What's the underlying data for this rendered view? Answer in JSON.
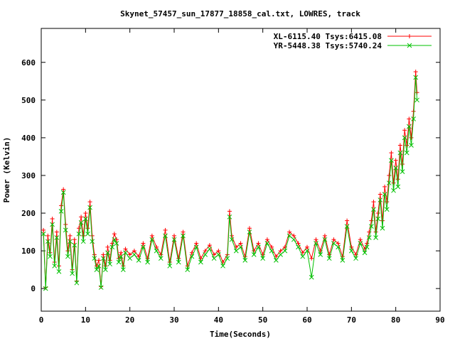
{
  "chart_data": {
    "type": "line",
    "title": "Skynet_57457_sun_17877_18858_cal.txt, LOWRES, track",
    "xlabel": "Time(Seconds)",
    "ylabel": "Power (Kelvin)",
    "xlim": [
      0,
      90
    ],
    "ylim": [
      -60,
      690
    ],
    "xticks": [
      0,
      10,
      20,
      30,
      40,
      50,
      60,
      70,
      80,
      90
    ],
    "yticks": [
      0,
      100,
      200,
      300,
      400,
      500,
      600
    ],
    "grid": false,
    "legend_position": "top-right",
    "series": [
      {
        "name": "XL-6115.40 Tsys:6415.08",
        "color": "#ff0000",
        "marker": "plus",
        "x": [
          0.5,
          1.0,
          1.5,
          2.0,
          2.5,
          3.0,
          3.5,
          4.0,
          4.5,
          5.0,
          5.5,
          6.0,
          6.5,
          7.0,
          7.5,
          8.0,
          8.5,
          9.0,
          9.5,
          10.0,
          10.5,
          11.0,
          11.5,
          12.0,
          12.5,
          13.0,
          13.5,
          14.0,
          14.5,
          15.0,
          15.5,
          16.0,
          16.5,
          17.0,
          17.5,
          18.0,
          18.5,
          19.0,
          20.0,
          21.0,
          22.0,
          23.0,
          24.0,
          25.0,
          26.0,
          27.0,
          28.0,
          29.0,
          30.0,
          31.0,
          32.0,
          33.0,
          34.0,
          35.0,
          36.0,
          37.0,
          38.0,
          39.0,
          40.0,
          41.0,
          42.0,
          42.5,
          43.0,
          44.0,
          45.0,
          46.0,
          47.0,
          48.0,
          49.0,
          50.0,
          51.0,
          52.0,
          53.0,
          54.0,
          55.0,
          56.0,
          57.0,
          58.0,
          59.0,
          60.0,
          61.0,
          62.0,
          63.0,
          64.0,
          65.0,
          66.0,
          67.0,
          68.0,
          69.0,
          70.0,
          71.0,
          72.0,
          73.0,
          73.5,
          74.0,
          74.5,
          75.0,
          75.5,
          76.0,
          76.5,
          77.0,
          77.5,
          78.0,
          78.5,
          79.0,
          79.5,
          80.0,
          80.5,
          81.0,
          81.5,
          82.0,
          82.5,
          83.0,
          83.5,
          84.0,
          84.5,
          84.8
        ],
        "values": [
          155,
          3,
          140,
          95,
          185,
          70,
          150,
          60,
          220,
          263,
          170,
          100,
          140,
          50,
          130,
          20,
          160,
          190,
          140,
          200,
          160,
          230,
          140,
          90,
          60,
          75,
          5,
          90,
          60,
          110,
          75,
          120,
          145,
          130,
          80,
          95,
          60,
          105,
          90,
          100,
          85,
          120,
          80,
          140,
          110,
          90,
          155,
          70,
          140,
          80,
          150,
          60,
          95,
          120,
          80,
          100,
          115,
          90,
          100,
          70,
          90,
          205,
          140,
          110,
          120,
          85,
          160,
          100,
          120,
          90,
          130,
          110,
          85,
          100,
          110,
          150,
          140,
          120,
          95,
          110,
          80,
          130,
          100,
          140,
          90,
          130,
          120,
          85,
          180,
          110,
          90,
          130,
          105,
          120,
          150,
          180,
          230,
          150,
          200,
          250,
          180,
          270,
          230,
          300,
          360,
          280,
          340,
          290,
          380,
          330,
          420,
          380,
          450,
          400,
          470,
          575,
          520
        ]
      },
      {
        "name": "YR-5448.38 Tsys:5740.24",
        "color": "#00c000",
        "marker": "cross",
        "x": [
          0.5,
          1.0,
          1.5,
          2.0,
          2.5,
          3.0,
          3.5,
          4.0,
          4.5,
          5.0,
          5.5,
          6.0,
          6.5,
          7.0,
          7.5,
          8.0,
          8.5,
          9.0,
          9.5,
          10.0,
          10.5,
          11.0,
          11.5,
          12.0,
          12.5,
          13.0,
          13.5,
          14.0,
          14.5,
          15.0,
          15.5,
          16.0,
          16.5,
          17.0,
          17.5,
          18.0,
          18.5,
          19.0,
          20.0,
          21.0,
          22.0,
          23.0,
          24.0,
          25.0,
          26.0,
          27.0,
          28.0,
          29.0,
          30.0,
          31.0,
          32.0,
          33.0,
          34.0,
          35.0,
          36.0,
          37.0,
          38.0,
          39.0,
          40.0,
          41.0,
          42.0,
          42.5,
          43.0,
          44.0,
          45.0,
          46.0,
          47.0,
          48.0,
          49.0,
          50.0,
          51.0,
          52.0,
          53.0,
          54.0,
          55.0,
          56.0,
          57.0,
          58.0,
          59.0,
          60.0,
          61.0,
          62.0,
          63.0,
          64.0,
          65.0,
          66.0,
          67.0,
          68.0,
          69.0,
          70.0,
          71.0,
          72.0,
          73.0,
          73.5,
          74.0,
          74.5,
          75.0,
          75.5,
          76.0,
          76.5,
          77.0,
          77.5,
          78.0,
          78.5,
          79.0,
          79.5,
          80.0,
          80.5,
          81.0,
          81.5,
          82.0,
          82.5,
          83.0,
          83.5,
          84.0,
          84.5,
          84.8
        ],
        "values": [
          145,
          0,
          125,
          85,
          170,
          60,
          135,
          45,
          205,
          255,
          155,
          85,
          125,
          40,
          115,
          15,
          145,
          175,
          125,
          185,
          145,
          215,
          125,
          80,
          50,
          60,
          3,
          80,
          50,
          95,
          65,
          110,
          130,
          120,
          70,
          85,
          50,
          95,
          80,
          90,
          75,
          110,
          70,
          130,
          100,
          80,
          140,
          60,
          130,
          70,
          140,
          50,
          85,
          110,
          70,
          90,
          105,
          80,
          90,
          60,
          80,
          190,
          130,
          100,
          110,
          75,
          150,
          90,
          110,
          80,
          120,
          100,
          75,
          90,
          100,
          140,
          130,
          110,
          85,
          100,
          30,
          120,
          90,
          130,
          80,
          120,
          110,
          75,
          165,
          100,
          80,
          120,
          95,
          110,
          135,
          165,
          210,
          135,
          185,
          235,
          160,
          250,
          210,
          280,
          340,
          260,
          320,
          270,
          360,
          310,
          400,
          360,
          430,
          380,
          450,
          560,
          500
        ]
      }
    ]
  }
}
